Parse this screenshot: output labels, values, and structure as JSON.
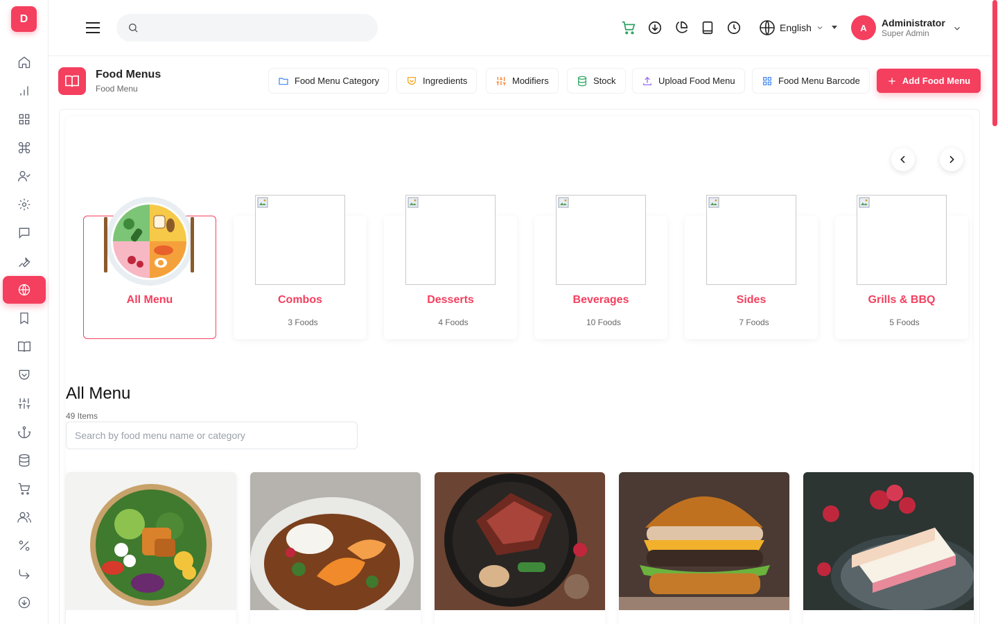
{
  "logo": {
    "letter": "D"
  },
  "sidebar": {
    "items": [
      {
        "icon": "home-icon"
      },
      {
        "icon": "bar-chart-icon"
      },
      {
        "icon": "grid-icon"
      },
      {
        "icon": "command-icon"
      },
      {
        "icon": "user-check-icon"
      },
      {
        "icon": "gear-icon"
      },
      {
        "icon": "message-icon"
      },
      {
        "icon": "wrench-icon"
      },
      {
        "icon": "globe-icon",
        "active": true
      },
      {
        "icon": "bookmark-icon"
      },
      {
        "icon": "book-open-icon"
      },
      {
        "icon": "pocket-icon"
      },
      {
        "icon": "sliders-icon"
      },
      {
        "icon": "anchor-icon"
      },
      {
        "icon": "database-icon"
      },
      {
        "icon": "cart-icon"
      },
      {
        "icon": "users-icon"
      },
      {
        "icon": "percent-icon"
      },
      {
        "icon": "corner-down-right-icon"
      },
      {
        "icon": "arrow-down-circle-icon"
      }
    ]
  },
  "header": {
    "search_placeholder": "",
    "language": "English",
    "user": {
      "initial": "A",
      "name": "Administrator",
      "role": "Super Admin"
    },
    "icons": [
      "cart-icon",
      "download-icon",
      "pie-chart-icon",
      "tablet-icon",
      "clock-icon"
    ]
  },
  "page": {
    "title": "Food Menus",
    "subtitle": "Food Menu"
  },
  "toolbar": {
    "category": "Food Menu Category",
    "ingredients": "Ingredients",
    "modifiers": "Modifiers",
    "stock": "Stock",
    "upload": "Upload Food Menu",
    "barcode": "Food Menu Barcode",
    "add": "Add Food Menu"
  },
  "categories": [
    {
      "name": "All Menu",
      "count": "",
      "active": true
    },
    {
      "name": "Combos",
      "count": "3 Foods"
    },
    {
      "name": "Desserts",
      "count": "4 Foods"
    },
    {
      "name": "Beverages",
      "count": "10 Foods"
    },
    {
      "name": "Sides",
      "count": "7 Foods"
    },
    {
      "name": "Grills & BBQ",
      "count": "5 Foods"
    }
  ],
  "menu_list": {
    "title": "All Menu",
    "count": "49 Items",
    "search_placeholder": "Search by food menu name or category"
  },
  "foods": [
    {
      "image": "salad-bowl"
    },
    {
      "image": "shrimp-curry-rice"
    },
    {
      "image": "steak-platter"
    },
    {
      "image": "cheeseburger"
    },
    {
      "image": "raspberry-cake"
    }
  ],
  "colors": {
    "accent": "#f43f5e",
    "cart_icon": "#22a05a"
  }
}
